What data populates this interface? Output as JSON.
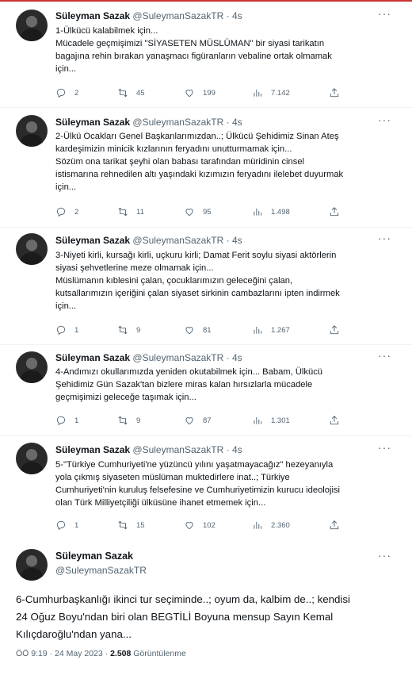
{
  "author": {
    "name": "Süleyman Sazak",
    "handle": "@SuleymanSazakTR"
  },
  "tweets": [
    {
      "time": "4s",
      "lines": [
        "1-Ülkücü kalabilmek için...",
        "Mücadele geçmişimizi \"SİYASETEN MÜSLÜMAN\" bir siyasi tarikatın",
        "bagajına rehin bırakan yanaşmacı figüranların vebaline ortak olmamak",
        "için..."
      ],
      "replies": "2",
      "retweets": "45",
      "likes": "199",
      "views": "7.142"
    },
    {
      "time": "4s",
      "lines": [
        "2-Ülkü Ocakları Genel Başkanlarımızdan..; Ülkücü Şehidimiz Sinan Ateş",
        "kardeşimizin minicik kızlarının feryadını unutturmamak için...",
        "Sözüm ona tarikat şeyhi olan babası tarafından müridinin cinsel",
        "istismarına rehnedilen altı yaşındaki kızımızın feryadını ilelebet duyurmak",
        "için..."
      ],
      "replies": "2",
      "retweets": "11",
      "likes": "95",
      "views": "1.498"
    },
    {
      "time": "4s",
      "lines": [
        "3-Niyeti kirli, kursağı kirli, uçkuru kirli; Damat Ferit soylu siyasi aktörlerin",
        "siyasi şehvetlerine meze olmamak için...",
        "Müslümanın kıblesini çalan, çocuklarımızın geleceğini çalan,",
        "kutsallarımızın içeriğini çalan siyaset sirkinin cambazlarını ipten indirmek",
        "için..."
      ],
      "replies": "1",
      "retweets": "9",
      "likes": "81",
      "views": "1.267"
    },
    {
      "time": "4s",
      "lines": [
        "4-Andımızı okullarımızda yeniden okutabilmek için... Babam, Ülkücü",
        "Şehidimiz Gün Sazak'tan bizlere miras kalan hırsızlarla mücadele",
        "geçmişimizi geleceğe taşımak için..."
      ],
      "replies": "1",
      "retweets": "9",
      "likes": "87",
      "views": "1.301"
    },
    {
      "time": "4s",
      "lines": [
        "5-\"Türkiye Cumhuriyeti'ne yüzüncü yılını yaşatmayacağız\" hezeyanıyla",
        "yola çıkmış siyaseten müslüman muktedirlere inat..; Türkiye",
        "Cumhuriyeti'nin kuruluş felsefesine ve Cumhuriyetimizin kurucu ideolojisi",
        "olan Türk Milliyetçiliği  ülküsüne ihanet etmemek için..."
      ],
      "replies": "1",
      "retweets": "15",
      "likes": "102",
      "views": "2.360"
    }
  ],
  "main": {
    "lines": [
      "6-Cumhurbaşkanlığı ikinci tur seçiminde..; oyum da, kalbim de..; kendisi",
      "24 Oğuz Boyu'ndan biri olan  BEGTİLİ Boyuna mensup Sayın Kemal",
      "Kılıçdaroğlu'ndan yana..."
    ],
    "timestamp": "ÖÖ 9:19 · 24 May 2023 · ",
    "view_count": "2.508",
    "view_label": " Görüntülenme"
  },
  "icons": {
    "reply": "reply-icon",
    "retweet": "retweet-icon",
    "like": "heart-icon",
    "views": "views-icon",
    "share": "share-icon",
    "more": "more-icon"
  }
}
